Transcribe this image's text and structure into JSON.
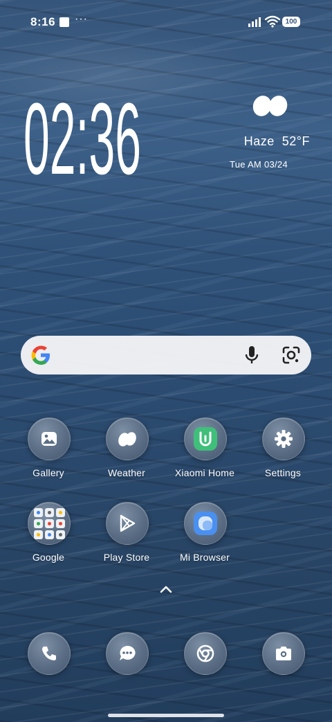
{
  "status_bar": {
    "time": "8:16",
    "notification_dots": "···",
    "battery_level": "100"
  },
  "clock_widget": {
    "time": "02:36"
  },
  "weather_widget": {
    "condition": "Haze",
    "temperature": "52°F",
    "date": "Tue AM 03/24"
  },
  "search": {
    "placeholder": ""
  },
  "apps": {
    "row1": [
      {
        "label": "Gallery",
        "icon": "gallery-icon"
      },
      {
        "label": "Weather",
        "icon": "weather-app-icon"
      },
      {
        "label": "Xiaomi Home",
        "icon": "xiaomi-home-icon"
      },
      {
        "label": "Settings",
        "icon": "gear-icon"
      }
    ],
    "row2": [
      {
        "label": "Google",
        "icon": "google-folder-icon"
      },
      {
        "label": "Play Store",
        "icon": "play-store-icon"
      },
      {
        "label": "Mi Browser",
        "icon": "mi-browser-icon"
      }
    ]
  },
  "dock": [
    "phone-icon",
    "messages-icon",
    "chrome-icon",
    "camera-icon"
  ],
  "colors": {
    "xiaomi_home_green": "#3fbf7a",
    "mi_browser_blue": "#4a90f0",
    "search_bar_bg": "#f5f6f8"
  }
}
